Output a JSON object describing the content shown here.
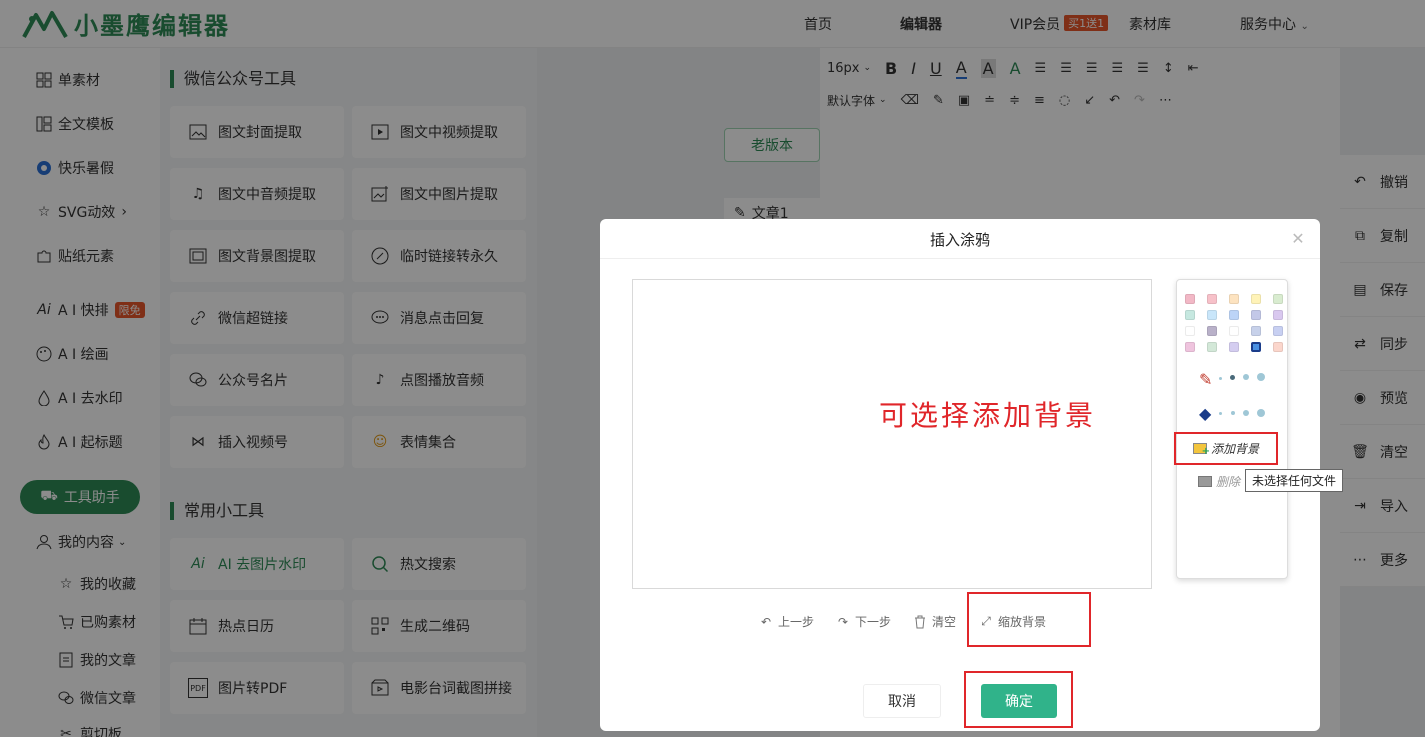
{
  "app": {
    "title": "小墨鹰编辑器",
    "accent": "#2e8b57"
  },
  "nav": {
    "home": "首页",
    "editor": "编辑器",
    "vip": "VIP会员",
    "vip_badge": "买1送1",
    "materials": "素材库",
    "service": "服务中心"
  },
  "sidebar": {
    "items": [
      {
        "label": "单素材",
        "icon": "grid-icon"
      },
      {
        "label": "全文模板",
        "icon": "template-icon"
      },
      {
        "label": "快乐暑假",
        "icon": "ball-icon"
      },
      {
        "label": "SVG动效",
        "icon": "star-icon"
      },
      {
        "label": "贴纸元素",
        "icon": "puzzle-icon"
      },
      {
        "label": "A I 快排",
        "icon": "ai-icon",
        "badge": "限免"
      },
      {
        "label": "A I 绘画",
        "icon": "palette-icon"
      },
      {
        "label": "A I 去水印",
        "icon": "drop-icon"
      },
      {
        "label": "A I 起标题",
        "icon": "fire-icon"
      }
    ],
    "tool_button": "工具助手",
    "my_content": "我的内容",
    "sub_items": [
      {
        "label": "我的收藏",
        "icon": "star-icon"
      },
      {
        "label": "已购素材",
        "icon": "cart-icon"
      },
      {
        "label": "我的文章",
        "icon": "document-icon"
      },
      {
        "label": "微信文章",
        "icon": "wechat-icon"
      },
      {
        "label": "剪切板",
        "icon": "scissors-icon"
      }
    ]
  },
  "tools": {
    "section1": "微信公众号工具",
    "section1_items": [
      "图文封面提取",
      "图文中视频提取",
      "图文中音频提取",
      "图文中图片提取",
      "图文背景图提取",
      "临时链接转永久",
      "微信超链接",
      "消息点击回复",
      "公众号名片",
      "点图播放音频",
      "插入视频号",
      "表情集合"
    ],
    "section2": "常用小工具",
    "section2_items": [
      "AI 去图片水印",
      "热文搜索",
      "热点日历",
      "生成二维码",
      "图片转PDF",
      "电影台词截图拼接"
    ]
  },
  "editor": {
    "font_size": "16px",
    "font_family": "默认字体",
    "old_version": "老版本",
    "article_tab": "文章1"
  },
  "actions": [
    "撤销",
    "复制",
    "保存",
    "同步",
    "预览",
    "清空",
    "导入",
    "更多"
  ],
  "modal": {
    "title": "插入涂鸦",
    "canvas_hint": "可选择添加背景",
    "add_background": "添加背景",
    "delete_background": "删除",
    "tooltip": "未选择任何文件",
    "undo": "上一步",
    "redo": "下一步",
    "clear": "清空",
    "zoom_background": "缩放背景",
    "cancel": "取消",
    "confirm": "确定",
    "swatches": [
      "#f2b8c6",
      "#f7c1c9",
      "#fde3c0",
      "#fff3b8",
      "#d9ecd0",
      "#c6e8e0",
      "#c9e6fa",
      "#bcd4f7",
      "#c3c8e8",
      "#d9c8ef",
      "#ffffff",
      "#b9b1c9",
      "#ffffff",
      "#c7d1ea",
      "#c8d0f2",
      "#efc4de",
      "#d3e8d8",
      "#d4cdf0",
      "#4a90e2",
      "#fbd6cc"
    ]
  }
}
